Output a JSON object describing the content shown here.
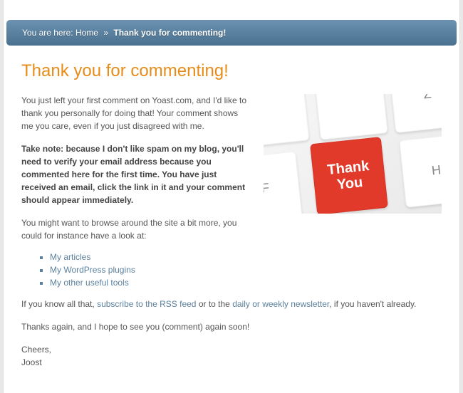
{
  "breadcrumb": {
    "prefix": "You are here:",
    "home": "Home",
    "sep": "»",
    "current": "Thank you for commenting!"
  },
  "page": {
    "title": "Thank you for commenting!",
    "intro": "You just left your first comment on Yoast.com, and I'd like to thank you personally for doing that! Your comment shows me you care, even if you just disagreed with me.",
    "note": "Take note: because I don't like spam on my blog, you'll need to verify your email address because you commented here for the first time. You have just received an email, click the link in it and your comment should appear immediately.",
    "browse": "You might want to browse around the site a bit more, you could for instance have a look at:",
    "links": {
      "articles": "My articles",
      "plugins": "My WordPress plugins",
      "tools": "My other useful tools"
    },
    "rss_pre": "If you know all that, ",
    "rss_link": "subscribe to the RSS feed",
    "rss_mid": " or to the ",
    "newsletter_link": "daily or weekly newsletter",
    "rss_post": ", if you haven't already.",
    "thanks_again": "Thanks again, and I hope to see you (comment) again soon!",
    "signoff": "Cheers,",
    "author": "Joost"
  },
  "image": {
    "thank": "Thank",
    "you": "You",
    "key_f": "F",
    "key_z": "Z",
    "key_h": "H"
  }
}
